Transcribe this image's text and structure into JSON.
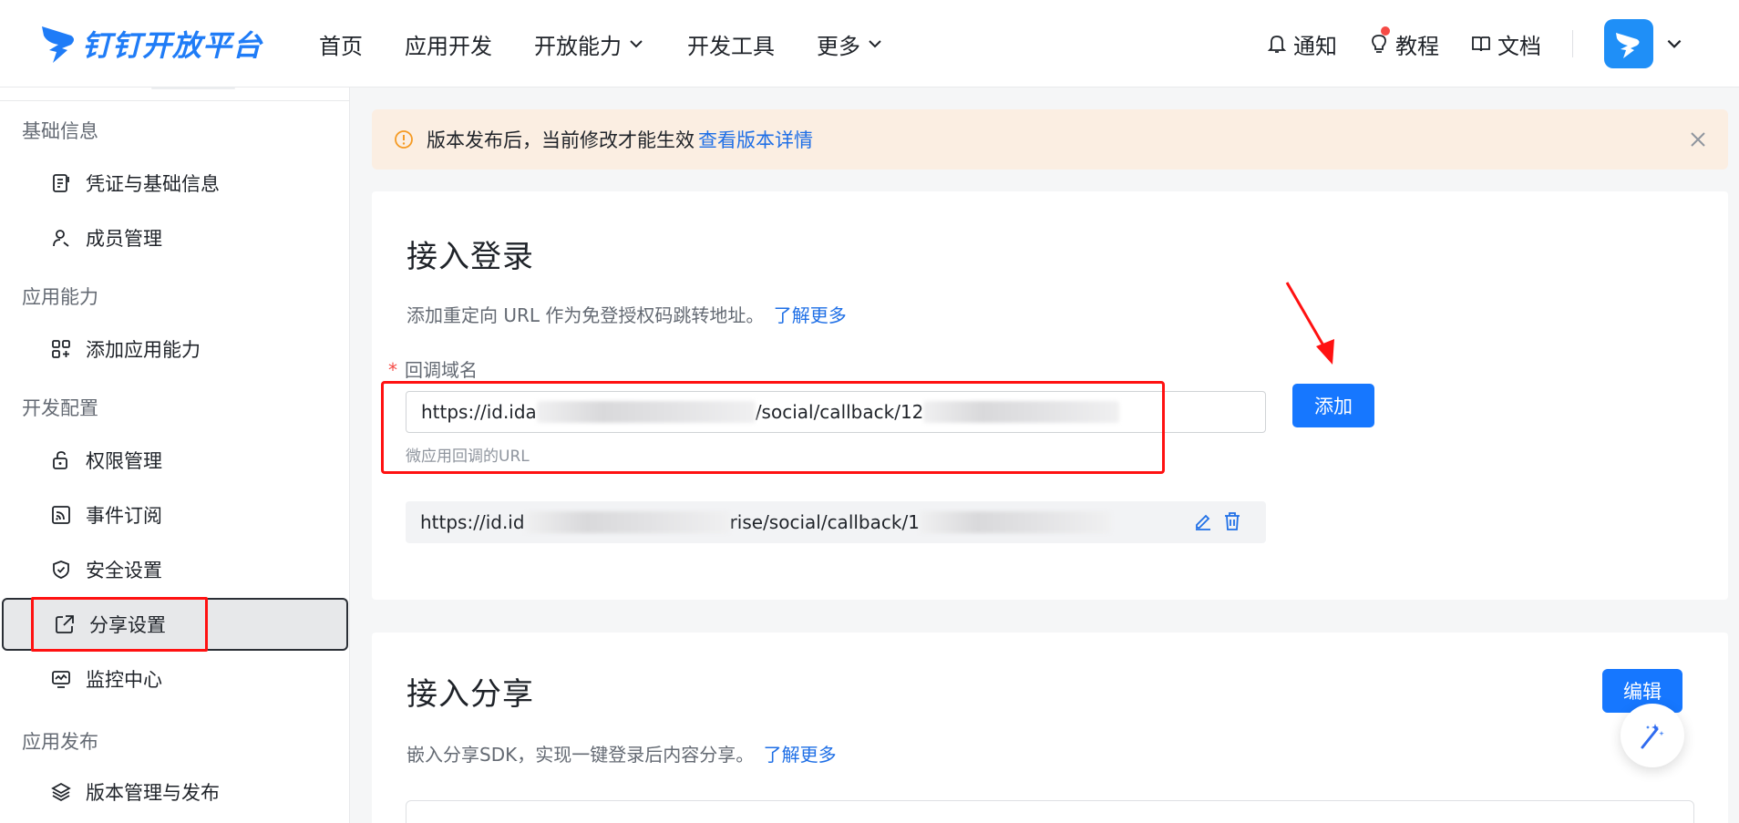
{
  "brand": {
    "name": "钉钉开放平台"
  },
  "nav": {
    "home": "首页",
    "app_dev": "应用开发",
    "open_ability": "开放能力",
    "dev_tools": "开发工具",
    "more": "更多"
  },
  "header_right": {
    "notify": "通知",
    "tutorial": "教程",
    "docs": "文档"
  },
  "sidebar": {
    "groups": {
      "basic": "基础信息",
      "ability": "应用能力",
      "config": "开发配置",
      "release": "应用发布"
    },
    "items": {
      "credentials": "凭证与基础信息",
      "members": "成员管理",
      "add_ability": "添加应用能力",
      "permissions": "权限管理",
      "events": "事件订阅",
      "security": "安全设置",
      "share": "分享设置",
      "monitor": "监控中心",
      "version": "版本管理与发布"
    }
  },
  "notice": {
    "text": "版本发布后，当前修改才能生效",
    "link": "查看版本详情"
  },
  "login_card": {
    "title": "接入登录",
    "desc": "添加重定向 URL 作为免登授权码跳转地址。",
    "learn_more": "了解更多",
    "field_label": "回调域名",
    "input_prefix": "https://id.ida",
    "input_mid": "/social/callback/12",
    "hint": "微应用回调的URL",
    "add_button": "添加",
    "saved_prefix": "https://id.id",
    "saved_mid": "rise/social/callback/1"
  },
  "share_card": {
    "title": "接入分享",
    "desc": "嵌入分享SDK，实现一键登录后内容分享。",
    "learn_more": "了解更多",
    "edit_button": "编辑"
  },
  "colors": {
    "primary": "#1677ff",
    "link": "#1f6fe6",
    "annotation_red": "#ff1111",
    "notice_bg": "#fbeee2"
  }
}
